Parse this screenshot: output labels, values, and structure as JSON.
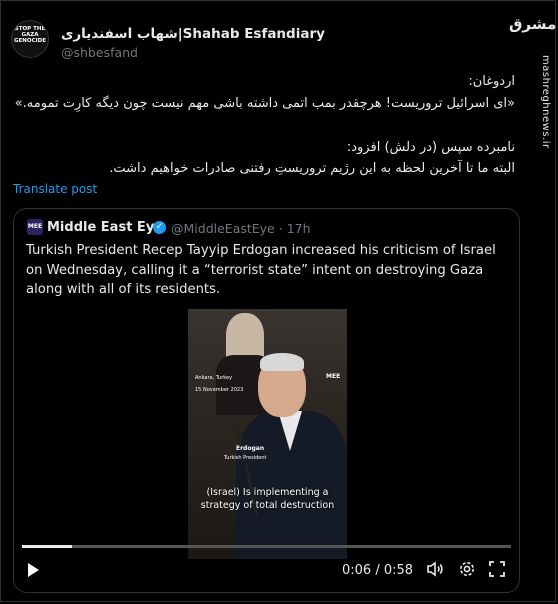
{
  "tweet": {
    "avatar_text": "STOP THE\nGAZA\nGENOCIDE",
    "display_name": "شهاب اسفندیاری|Shahab Esfandiary",
    "handle": "@shbesfand",
    "lines": [
      "اردوغان:",
      "«ای اسرائیل تروریست! هرچقدر بمب اتمی داشته باشی مهم نیست چون دیگه کارِت تمومه.»",
      "نامبرده سپس (در دلش) افزود:",
      "البته ما تا آخرین لحظه به این رژیم تروریستِ رفتنی صادرات خواهیم داشت."
    ],
    "translate_label": "Translate post"
  },
  "brand": {
    "logo_text": "مشرق",
    "watermark": "mashreghnews.ir"
  },
  "quote": {
    "avatar_text": "MEE",
    "name": "Middle East Eye",
    "verified_icon": "verified-check-icon",
    "handle": "@MiddleEastEye",
    "separator": "·",
    "age": "17h",
    "text": "Turkish President Recep Tayyip Erdogan increased his criticism of Israel on Wednesday, calling it a “terrorist state” intent on destroying Gaza along with all of its residents."
  },
  "video": {
    "location_label": "Ankara, Turkey",
    "date_label": "15 November 2023",
    "logo": "MEE",
    "speaker_label": "Erdogan",
    "speaker_title": "Turkish President",
    "subtitle_line1": "(Israel) Is implementing a",
    "subtitle_line2": "strategy of total destruction",
    "current_time": "0:06",
    "time_separator": "/",
    "duration": "0:58",
    "progress_fraction": 0.103,
    "icons": [
      "play-icon",
      "volume-icon",
      "settings-icon",
      "fullscreen-icon"
    ]
  }
}
